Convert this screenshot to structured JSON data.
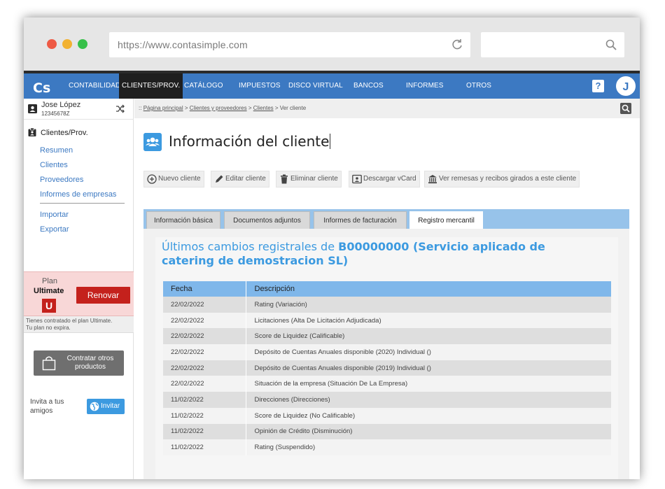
{
  "browser": {
    "url": "https://www.contasimple.com"
  },
  "topnav": {
    "logo": "Cs",
    "items": [
      {
        "label": "CONTABILIDAD"
      },
      {
        "label": "CLIENTES/PROV."
      },
      {
        "label": "CATÁLOGO"
      },
      {
        "label": "IMPUESTOS"
      },
      {
        "label": "DISCO VIRTUAL"
      },
      {
        "label": "BANCOS"
      },
      {
        "label": "INFORMES"
      },
      {
        "label": "OTROS"
      }
    ],
    "help": "?",
    "avatar": "J",
    "accent": "#3c79c2"
  },
  "sidebar": {
    "user_name": "Jose López",
    "user_nif": "12345678Z",
    "section": "Clientes/Prov.",
    "links": [
      {
        "label": "Resumen"
      },
      {
        "label": "Clientes"
      },
      {
        "label": "Proveedores"
      },
      {
        "label": "Informes de empresas"
      },
      {
        "label": "Importar"
      },
      {
        "label": "Exportar"
      }
    ],
    "plan_label": "Plan",
    "plan_name": "Ultimate",
    "plan_badge": "U",
    "renew_label": "Renovar",
    "plan_note_1": "Tienes contratado el plan Ultimate.",
    "plan_note_2": "Tu plan no expira.",
    "more_products": "Contratar otros productos",
    "invite_text": "Invita a tus amigos",
    "invite_button": "Invitar"
  },
  "breadcrumb": {
    "prefix": "::",
    "items": [
      "Página principal",
      "Clientes y proveedores",
      "Clientes"
    ],
    "current": "Ver cliente",
    "sep": ">"
  },
  "main": {
    "title": "Información del cliente",
    "actions": [
      {
        "label": "Nuevo cliente",
        "icon": "plus-circle-icon"
      },
      {
        "label": "Editar cliente",
        "icon": "pencil-icon"
      },
      {
        "label": "Eliminar cliente",
        "icon": "trash-icon"
      },
      {
        "label": "Descargar vCard",
        "icon": "vcard-icon"
      },
      {
        "label": "Ver remesas y recibos girados a este cliente",
        "icon": "bank-icon"
      }
    ],
    "tabs": [
      {
        "label": "Información básica"
      },
      {
        "label": "Documentos adjuntos"
      },
      {
        "label": "Informes de facturación"
      },
      {
        "label": "Registro mercantil",
        "active": true
      }
    ],
    "registry": {
      "title_prefix": "Últimos cambios registrales de",
      "title_company": "B00000000 (Servicio aplicado de catering de demostracion SL)",
      "columns": [
        "Fecha",
        "Descripción"
      ],
      "rows": [
        {
          "date": "22/02/2022",
          "desc": "Rating (Variación)"
        },
        {
          "date": "22/02/2022",
          "desc": "Licitaciones (Alta De Licitación Adjudicada)"
        },
        {
          "date": "22/02/2022",
          "desc": "Score de Liquidez (Calificable)"
        },
        {
          "date": "22/02/2022",
          "desc": "Depósito de Cuentas Anuales disponible (2020) Individual ()"
        },
        {
          "date": "22/02/2022",
          "desc": "Depósito de Cuentas Anuales disponible (2019) Individual ()"
        },
        {
          "date": "22/02/2022",
          "desc": "Situación de la empresa (Situación De La Empresa)"
        },
        {
          "date": "11/02/2022",
          "desc": "Direcciones (Direcciones)"
        },
        {
          "date": "11/02/2022",
          "desc": "Score de Liquidez (No Calificable)"
        },
        {
          "date": "11/02/2022",
          "desc": "Opinión de Crédito (Disminución)"
        },
        {
          "date": "11/02/2022",
          "desc": "Rating (Suspendido)"
        }
      ]
    }
  }
}
